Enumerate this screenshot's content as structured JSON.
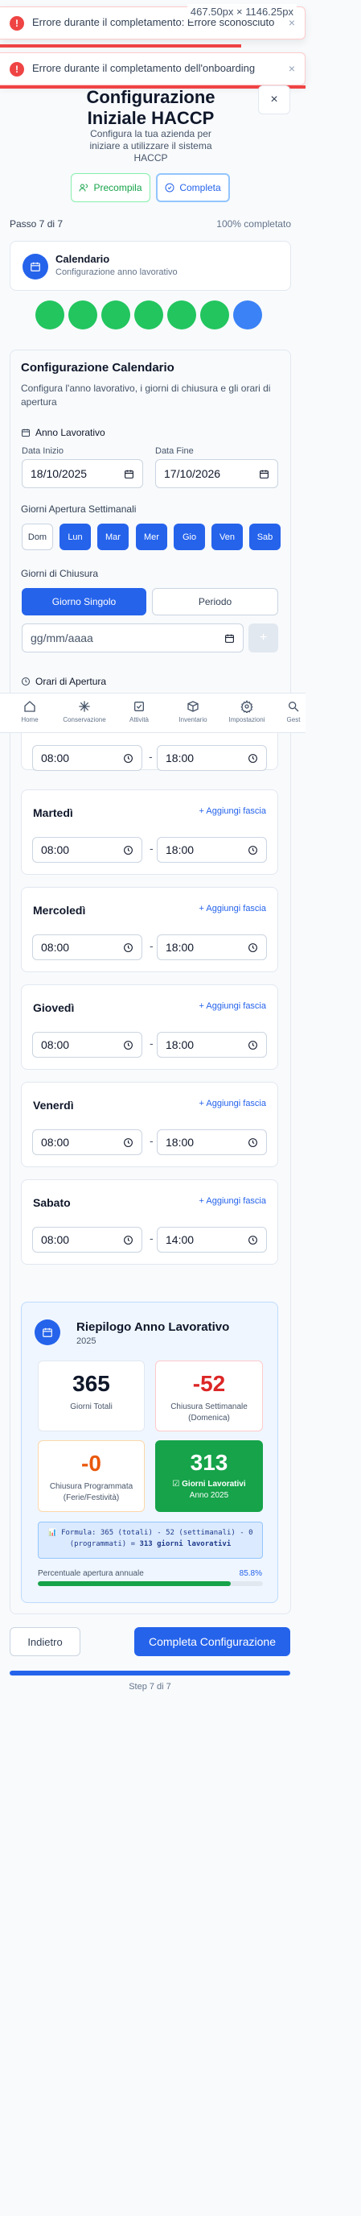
{
  "toasts": [
    {
      "message": "Errore durante il completamento: Errore sconosciuto"
    },
    {
      "message": "Errore durante il completamento dell'onboarding"
    }
  ],
  "size_badge": "467.50px × 1146.25px",
  "header": {
    "title": "Configurazione Iniziale HACCP",
    "subtitle": "Configura la tua azienda per iniziare a utilizzare il sistema HACCP",
    "prefill_label": "Precompila",
    "complete_label": "Completa",
    "close_label": "×"
  },
  "progress": {
    "step_label": "Passo 7 di 7",
    "percent_label": "100% completato"
  },
  "step_card": {
    "title": "Calendario",
    "subtitle": "Configurazione anno lavorativo"
  },
  "step_dots": [
    {
      "status": "done"
    },
    {
      "status": "done"
    },
    {
      "status": "done"
    },
    {
      "status": "done"
    },
    {
      "status": "done"
    },
    {
      "status": "done"
    },
    {
      "status": "current"
    }
  ],
  "calendar": {
    "title": "Configurazione Calendario",
    "description": "Configura l'anno lavorativo, i giorni di chiusura e gli orari di apertura",
    "year_section": "Anno Lavorativo",
    "start_label": "Data Inizio",
    "start_value": "18/10/2025",
    "end_label": "Data Fine",
    "end_value": "17/10/2026",
    "open_days_label": "Giorni Apertura Settimanali",
    "days": [
      {
        "label": "Dom",
        "active": false
      },
      {
        "label": "Lun",
        "active": true
      },
      {
        "label": "Mar",
        "active": true
      },
      {
        "label": "Mer",
        "active": true
      },
      {
        "label": "Gio",
        "active": true
      },
      {
        "label": "Ven",
        "active": true
      },
      {
        "label": "Sab",
        "active": true
      }
    ],
    "closure_label": "Giorni di Chiusura",
    "closure_single": "Giorno Singolo",
    "closure_period": "Periodo",
    "closure_date_placeholder": "gg/mm/aaaa",
    "add_closure": "+",
    "hours_section": "Orari di Apertura"
  },
  "nav": [
    {
      "label": "Home"
    },
    {
      "label": "Conservazione"
    },
    {
      "label": "Attività"
    },
    {
      "label": "Inventario"
    },
    {
      "label": "Impostazioni"
    },
    {
      "label": "Gest"
    }
  ],
  "hours": {
    "first_open": "08:00",
    "first_close": "18:00",
    "add_slot_label": "+ Aggiungi fascia",
    "days": [
      {
        "name": "Martedì",
        "open": "08:00",
        "close": "18:00"
      },
      {
        "name": "Mercoledì",
        "open": "08:00",
        "close": "18:00"
      },
      {
        "name": "Giovedì",
        "open": "08:00",
        "close": "18:00"
      },
      {
        "name": "Venerdì",
        "open": "08:00",
        "close": "18:00"
      },
      {
        "name": "Sabato",
        "open": "08:00",
        "close": "14:00"
      }
    ]
  },
  "summary": {
    "title": "Riepilogo Anno Lavorativo",
    "year": "2025",
    "total_value": "365",
    "total_label": "Giorni Totali",
    "weekly_value": "-52",
    "weekly_label": "Chiusura Settimanale",
    "weekly_sub": "(Domenica)",
    "programmed_value": "-0",
    "programmed_label": "Chiusura Programmata",
    "programmed_sub": "(Ferie/Festività)",
    "working_value": "313",
    "working_label": "☑ Giorni Lavorativi",
    "working_sub": "Anno 2025",
    "formula_prefix": "📊 Formula: 365 (totali) - 52 (settimanali) - 0",
    "formula_mid": "(programmati) = ",
    "formula_result": "313 giorni lavorativi",
    "opening_label": "Percentuale apertura annuale",
    "opening_value": "85.8%",
    "opening_fraction": 0.858
  },
  "footer": {
    "back_label": "Indietro",
    "complete_label": "Completa Configurazione",
    "step_text": "Step 7 di 7"
  },
  "colors": {
    "primary": "#2563eb",
    "success": "#22c55e",
    "danger": "#ef4444",
    "warning": "#ea580c"
  }
}
